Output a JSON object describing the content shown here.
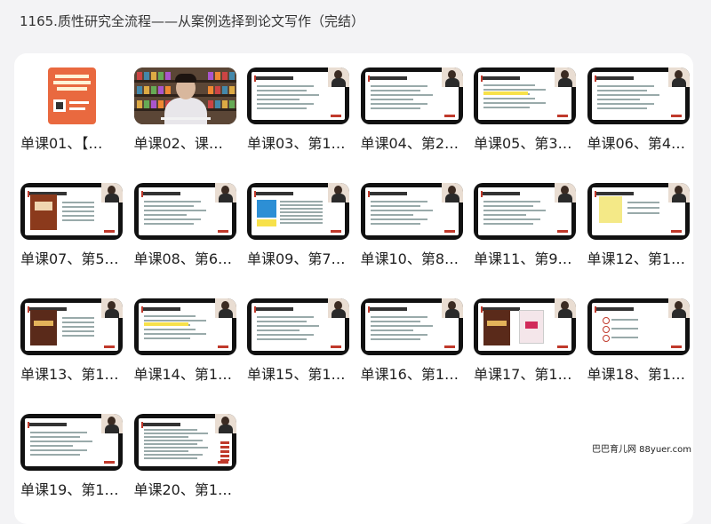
{
  "page": {
    "title": "1165.质性研究全流程——从案例选择到论文写作（完结）"
  },
  "lessons": [
    {
      "label": "单课01、【…",
      "thumb": "cover"
    },
    {
      "label": "单课02、课…",
      "thumb": "video"
    },
    {
      "label": "单课03、第1…",
      "thumb": "text-slide"
    },
    {
      "label": "单课04、第2…",
      "thumb": "text-slide"
    },
    {
      "label": "单课05、第3…",
      "thumb": "highlight-slide"
    },
    {
      "label": "单课06、第4…",
      "thumb": "text-slide"
    },
    {
      "label": "单课07、第5…",
      "thumb": "book-slide"
    },
    {
      "label": "单课08、第6…",
      "thumb": "text-slide"
    },
    {
      "label": "单课09、第7…",
      "thumb": "table-slide"
    },
    {
      "label": "单课10、第8…",
      "thumb": "text-slide"
    },
    {
      "label": "单课11、第9…",
      "thumb": "text-slide"
    },
    {
      "label": "单课12、第1…",
      "thumb": "yellow-slide"
    },
    {
      "label": "单课13、第1…",
      "thumb": "book-slide"
    },
    {
      "label": "单课14、第1…",
      "thumb": "highlight-slide"
    },
    {
      "label": "单课15、第1…",
      "thumb": "text-slide"
    },
    {
      "label": "单课16、第1…",
      "thumb": "text-slide"
    },
    {
      "label": "单课17、第1…",
      "thumb": "books-slide"
    },
    {
      "label": "单课18、第1…",
      "thumb": "list-slide"
    },
    {
      "label": "单课19、第1…",
      "thumb": "text-slide"
    },
    {
      "label": "单课20、第1…",
      "thumb": "doc-slide"
    }
  ],
  "watermark": "巴巴育儿网 88yuer.com"
}
